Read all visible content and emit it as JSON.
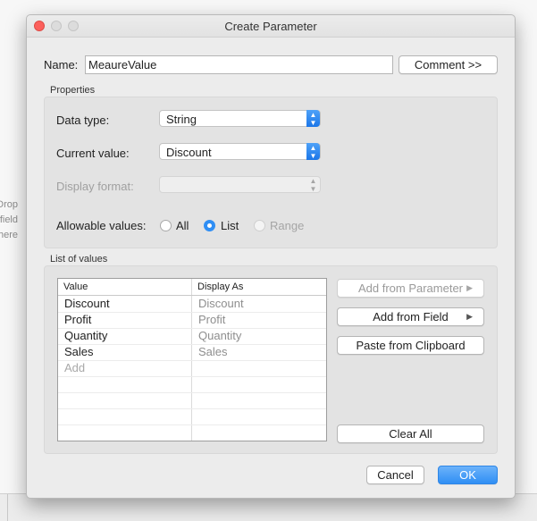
{
  "background": {
    "left_text": [
      "Drop",
      "field",
      "here"
    ]
  },
  "dialog": {
    "title": "Create Parameter",
    "name_label": "Name:",
    "name_value": "MeaureValue",
    "comment_button": "Comment >>",
    "properties_label": "Properties",
    "data_type_label": "Data type:",
    "data_type_value": "String",
    "current_value_label": "Current value:",
    "current_value_value": "Discount",
    "display_format_label": "Display format:",
    "allowable_values_label": "Allowable values:",
    "allowable_options": [
      {
        "label": "All",
        "checked": false,
        "enabled": true
      },
      {
        "label": "List",
        "checked": true,
        "enabled": true
      },
      {
        "label": "Range",
        "checked": false,
        "enabled": false
      }
    ],
    "list_label": "List of values",
    "columns": [
      "Value",
      "Display As"
    ],
    "rows": [
      {
        "value": "Discount",
        "display": "Discount"
      },
      {
        "value": "Profit",
        "display": "Profit"
      },
      {
        "value": "Quantity",
        "display": "Quantity"
      },
      {
        "value": "Sales",
        "display": "Sales"
      }
    ],
    "add_placeholder": "Add",
    "add_from_parameter": "Add from Parameter",
    "add_from_field": "Add from Field",
    "paste_from_clipboard": "Paste from Clipboard",
    "clear_all": "Clear All",
    "cancel": "Cancel",
    "ok": "OK",
    "arrow_glyph": "▶"
  },
  "colors": {
    "accent": "#2f8ef4",
    "close": "#fc605c"
  }
}
